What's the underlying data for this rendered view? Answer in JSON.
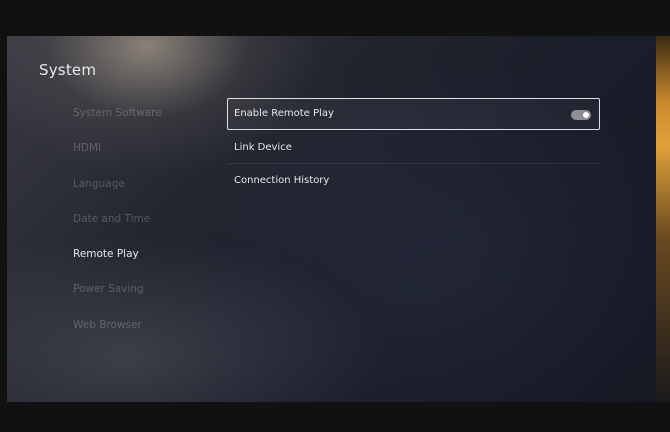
{
  "header": {
    "title": "System"
  },
  "sidebar": {
    "items": [
      {
        "label": "System Software",
        "active": false
      },
      {
        "label": "HDMI",
        "active": false
      },
      {
        "label": "Language",
        "active": false
      },
      {
        "label": "Date and Time",
        "active": false
      },
      {
        "label": "Remote Play",
        "active": true
      },
      {
        "label": "Power Saving",
        "active": false
      },
      {
        "label": "Web Browser",
        "active": false
      }
    ]
  },
  "options": {
    "enable_remote_play": {
      "label": "Enable Remote Play",
      "toggle_on": true
    },
    "link_device": {
      "label": "Link Device"
    },
    "connection_history": {
      "label": "Connection History"
    }
  }
}
